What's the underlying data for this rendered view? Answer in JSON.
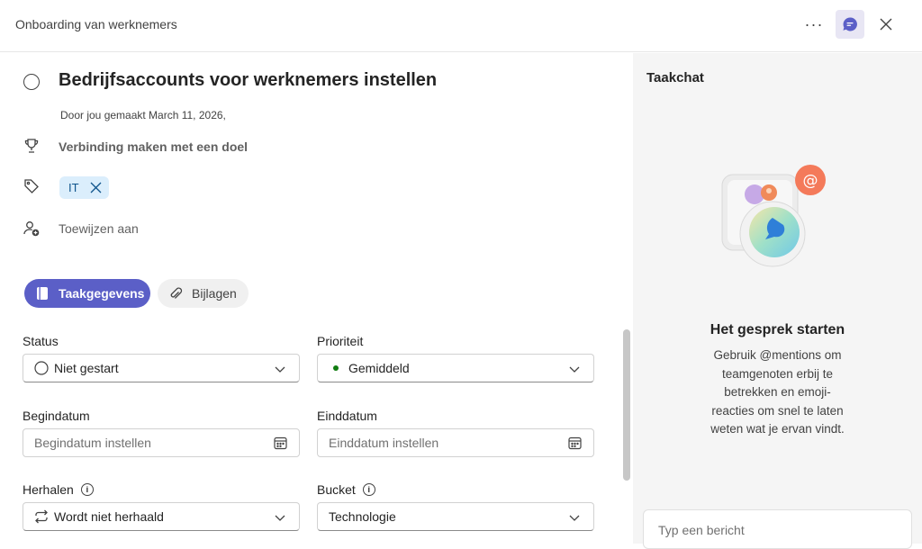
{
  "window": {
    "title": "Onboarding van werknemers",
    "more_label": "···"
  },
  "task": {
    "title": "Bedrijfsaccounts voor werknemers instellen",
    "created": "Door jou gemaakt March 11, 2026,",
    "goal": "Verbinding maken met een doel",
    "tag": "IT",
    "assign": "Toewijzen aan"
  },
  "tabs": {
    "details": "Taakgegevens",
    "attachments": "Bijlagen"
  },
  "fields": {
    "status": {
      "label": "Status",
      "value": "Niet gestart"
    },
    "priority": {
      "label": "Prioriteit",
      "value": "Gemiddeld",
      "dot_color": "#107c10"
    },
    "start": {
      "label": "Begindatum",
      "placeholder": "Begindatum instellen"
    },
    "end": {
      "label": "Einddatum",
      "placeholder": "Einddatum instellen"
    },
    "repeat": {
      "label": "Herhalen",
      "value": "Wordt niet herhaald"
    },
    "bucket": {
      "label": "Bucket",
      "value": "Technologie"
    }
  },
  "chat": {
    "title": "Taakchat",
    "heading": "Het gesprek starten",
    "text": "Gebruik @mentions om teamgenoten erbij te betrekken en emoji-reacties om snel te laten weten wat je ervan vindt.",
    "placeholder": "Typ een bericht"
  },
  "colors": {
    "accent": "#5b5fc7",
    "tag_bg": "#dbeefc",
    "tag_text": "#0f548c"
  }
}
